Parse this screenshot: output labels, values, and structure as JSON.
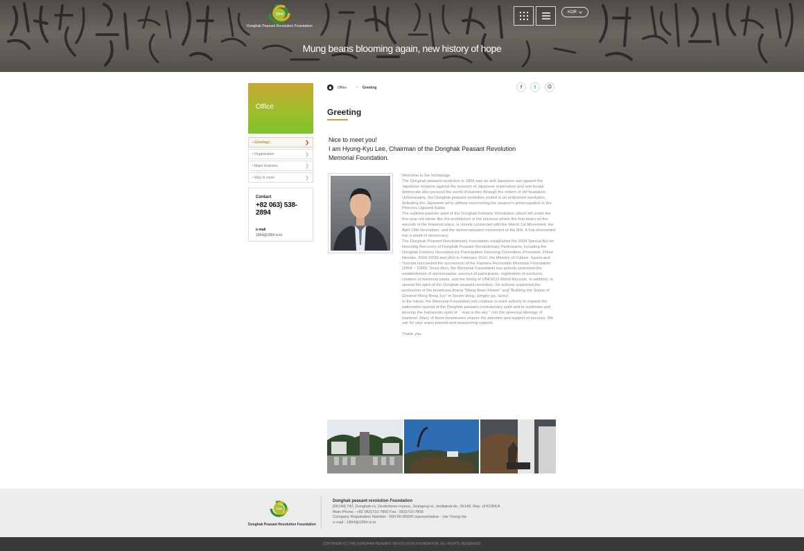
{
  "header": {
    "logo_year": "1894",
    "logo_name": "Donghak Peasant Revolution Foundation",
    "language": "KOR",
    "hero_text": "Mung beans blooming again, new history of hope"
  },
  "sidebar": {
    "banner_title": "Office",
    "items": [
      {
        "label": "• Greetings"
      },
      {
        "label": "• Organization"
      },
      {
        "label": "• Major business"
      },
      {
        "label": "• Way to come"
      }
    ],
    "contact": {
      "label": "Contact",
      "phone": "+82 063) 538-2894",
      "email_label": "e-mail",
      "email": "1894@1894.or.kr"
    }
  },
  "breadcrumb": {
    "section": "Office",
    "separator": ">",
    "current": "Greeting"
  },
  "share": {
    "facebook": "f",
    "twitter": "t",
    "print": "⎙"
  },
  "page_title": "Greeting",
  "greeting": {
    "line1": "Nice to meet you!",
    "line2": "I am Hyung-Kyu Lee, Chairman of the Donghak Peasant Revolution",
    "line3": "Memorial Foundation."
  },
  "body": {
    "p1": "Welcome to the homepage.",
    "p2": "The Donghak peasant revolution in 1894 was an anti-Japanese war against the Japanese invasion against the invasion of Japanese imperialists and anti-feudal democrats who pursued the world of manmin through the reform of old feudalism. Unfortunately, the Donghak peasant revolution ended in an unfinished revolution, defeating the Japanese army without overcoming the weapon's preoccupation in the Princess Ugeumti Battle.",
    "p3": "The sublime patriotic spirit of the Donghak Farmers' Revolution, which fell under the five-year-old winter like the providence of the universe where the fruit bears on the wounds of the flowered place, is closely connected with the March 1st Movement, the April 19th Revolution, and the democratization movement of the 80s. It has blossomed into a world of democracy.",
    "p4": "The Donghak Peasant Revolutionary Foundation established the 2004 Special Act on Honoring Recovery of Donghak Peasant Revolutionary Participants, including the Donghak Farmers Revolutionary Participation Honoring Committee (President: Prime Minister, 2004-2009) and (Re) In February 2010, the Ministry of Culture, Sports and Tourism succeeded the succession of the Farmers Revolution Memorial Foundation (2004 ~ 2009). Since then, the Memorial Foundation has actively promoted the establishment of anniversaries, surveys of participants, registration of survivors, creation of memorial parks, and the listing of UNESCO World Records. In addition, to spread the spirit of the Donghak peasant revolution, we actively supported the production of the broadcast drama \"Mung Bean Flower\" and \"Building the Statue of General Mung Bong Jun\" in Seorin-dong, Jongno-gu, Seoul.",
    "p5": "In the future, the Memorial Foundation will continue to work actively to expand the nationwide spread of the Donghak peasant revolutionary spirit and to sublimate and develop the humanistic spirit of `` man is the sky '' into the universal ideology of mankind. Many of these businesses require the attention and support of success. We ask for your warm interest and unwavering support.",
    "thanks": "Thank you."
  },
  "footer": {
    "logo_year": "1894",
    "logo_name": "Donghak Peasant Revolution Foundation",
    "org": "Donghak peasant revolution Foundation",
    "address": "[56149] 742, Donghak-ro, Deokcheon-myeon, Jeongeup-si, Jeollabuk-do, 56149, Rep. of KOREA",
    "phone": "Main Phone : +82 063)710-7800    Fax : 063)710-7809",
    "registration": "Company Registration Number : 000-00-00000    representative : Jae Young Ha",
    "email": "e-mail : 1894@1894.or.kr",
    "copyright": "COPYRIGHT(C) THE DONGHAK PEASANT REVOLUTION FOUNDATION. ALL RIGHTS RESERVED."
  },
  "colors": {
    "accent_gold": "#c9a630",
    "accent_green": "#7fc22a",
    "footer_bg": "#ececec",
    "copyright_bg": "#3a3a3a"
  }
}
